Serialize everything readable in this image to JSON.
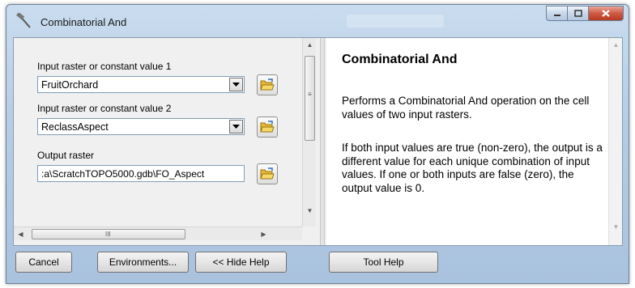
{
  "window": {
    "title": "Combinatorial And"
  },
  "form": {
    "input1": {
      "label": "Input raster or constant value 1",
      "value": "FruitOrchard"
    },
    "input2": {
      "label": "Input raster or constant value 2",
      "value": "ReclassAspect"
    },
    "output": {
      "label": "Output raster",
      "value": ":a\\ScratchTOPO5000.gdb\\FO_Aspect"
    }
  },
  "help": {
    "title": "Combinatorial And",
    "para1": "Performs a Combinatorial And operation on the cell values of two input rasters.",
    "para2": "If both input values are true (non-zero), the output is a different value for each unique combination of input values. If one or both inputs are false (zero), the output value is 0."
  },
  "buttons": {
    "cancel": "Cancel",
    "environments": "Environments...",
    "hide_help": "<< Hide Help",
    "tool_help": "Tool Help"
  },
  "icons": {
    "title": "tool-hammer-icon",
    "folder": "open-folder-icon"
  },
  "colors": {
    "titlebar": "#b7cde6",
    "close_button": "#cf5a44",
    "folder_icon": "#e8b933"
  }
}
